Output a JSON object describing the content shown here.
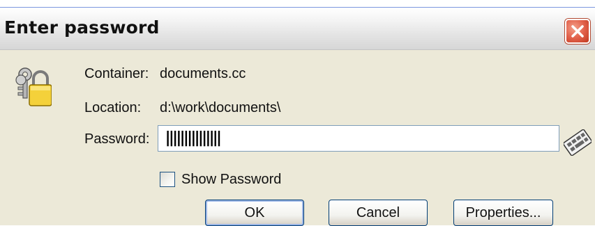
{
  "window": {
    "title": "Enter password",
    "close_icon": "close-icon"
  },
  "info": {
    "container_label": "Container:",
    "container_value": "documents.cc",
    "location_label": "Location:",
    "location_value": "d:\\work\\documents\\"
  },
  "password": {
    "label": "Password:",
    "masked_value": "|||||||||||||||",
    "keyboard_icon": "virtual-keyboard-icon"
  },
  "show_password": {
    "label": "Show Password",
    "checked": false
  },
  "buttons": {
    "ok": "OK",
    "cancel": "Cancel",
    "properties": "Properties..."
  },
  "icons": {
    "dialog_icon": "keys-padlock-icon"
  },
  "colors": {
    "dialog_bg": "#ece9d8",
    "close_red": "#e2614b",
    "focus_blue": "#9cb6e6"
  }
}
